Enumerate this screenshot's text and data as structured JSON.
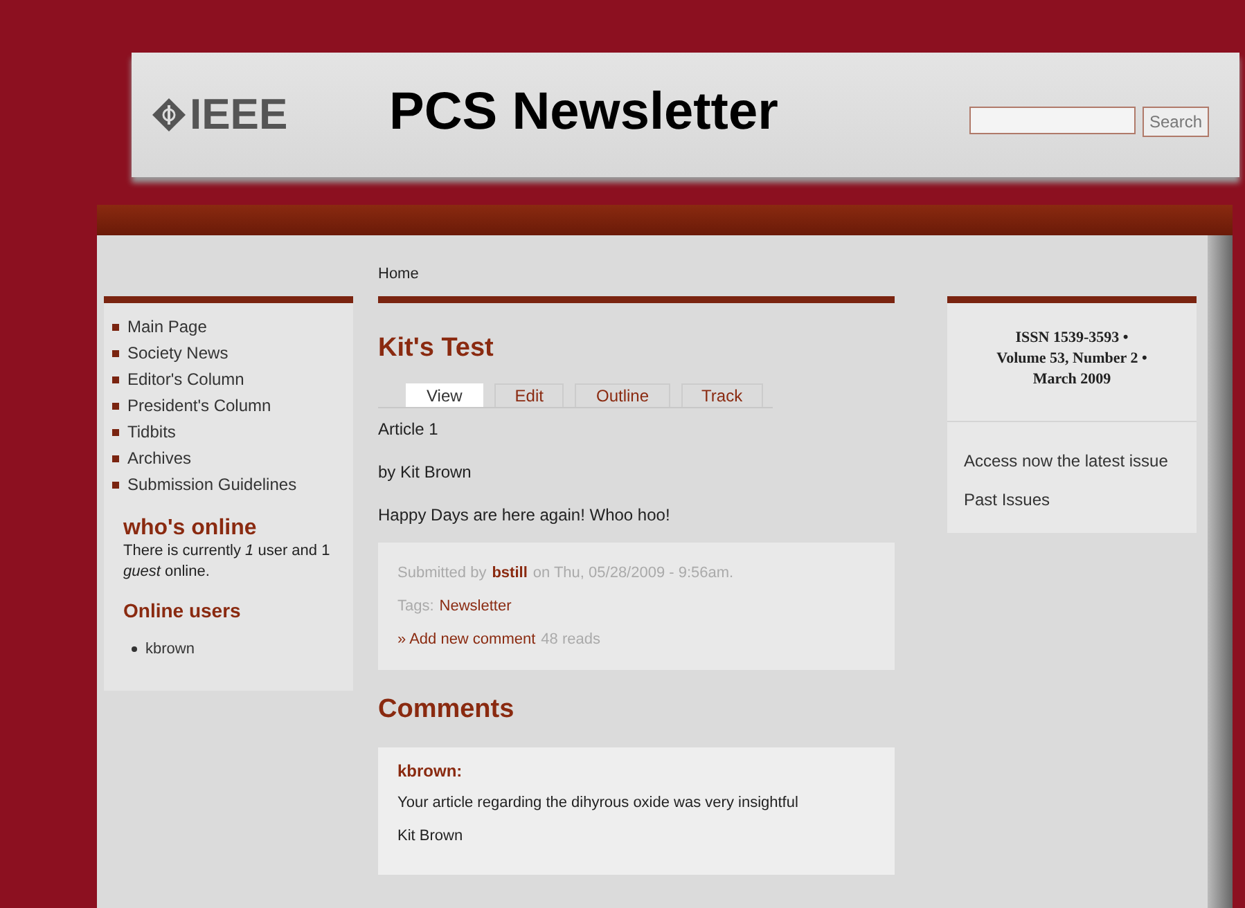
{
  "header": {
    "logo": "IEEE",
    "title": "PCS Newsletter",
    "search": {
      "button": "Search"
    }
  },
  "sidebar": {
    "menu": [
      "Main Page",
      "Society News",
      "Editor's Column",
      "President's Column",
      "Tidbits",
      "Archives",
      "Submission Guidelines"
    ],
    "whos_online": {
      "title": "who's online",
      "text": "There is currently *1* user and 1 *guest* online.",
      "subtitle": "Online users",
      "users": [
        "kbrown"
      ]
    }
  },
  "breadcrumb": "Home",
  "article": {
    "title": "Kit's Test",
    "tabs": [
      {
        "label": "View",
        "selected": true
      },
      {
        "label": "Edit",
        "selected": false
      },
      {
        "label": "Outline",
        "selected": false
      },
      {
        "label": "Track",
        "selected": false
      }
    ],
    "paragraphs": [
      "Article 1",
      "by Kit Brown",
      "Happy Days are here again! Whoo hoo!"
    ],
    "meta": {
      "submitted_prefix": "Submitted by",
      "author": "bstill",
      "submitted_suffix": "on Thu, 05/28/2009 - 9:56am.",
      "tags_label": "Tags:",
      "tag": "Newsletter",
      "add_comment": "» Add new comment",
      "reads": "48 reads"
    }
  },
  "comments": {
    "title": "Comments",
    "items": [
      {
        "author": "kbrown:",
        "text": "Your article regarding the dihyrous oxide was very insightful",
        "signature": "Kit Brown"
      }
    ]
  },
  "right": {
    "issue": [
      "ISSN 1539-3593 •",
      "Volume 53, Number 2 •",
      "March 2009"
    ],
    "links": [
      "Access now the latest issue",
      "Past Issues"
    ]
  }
}
